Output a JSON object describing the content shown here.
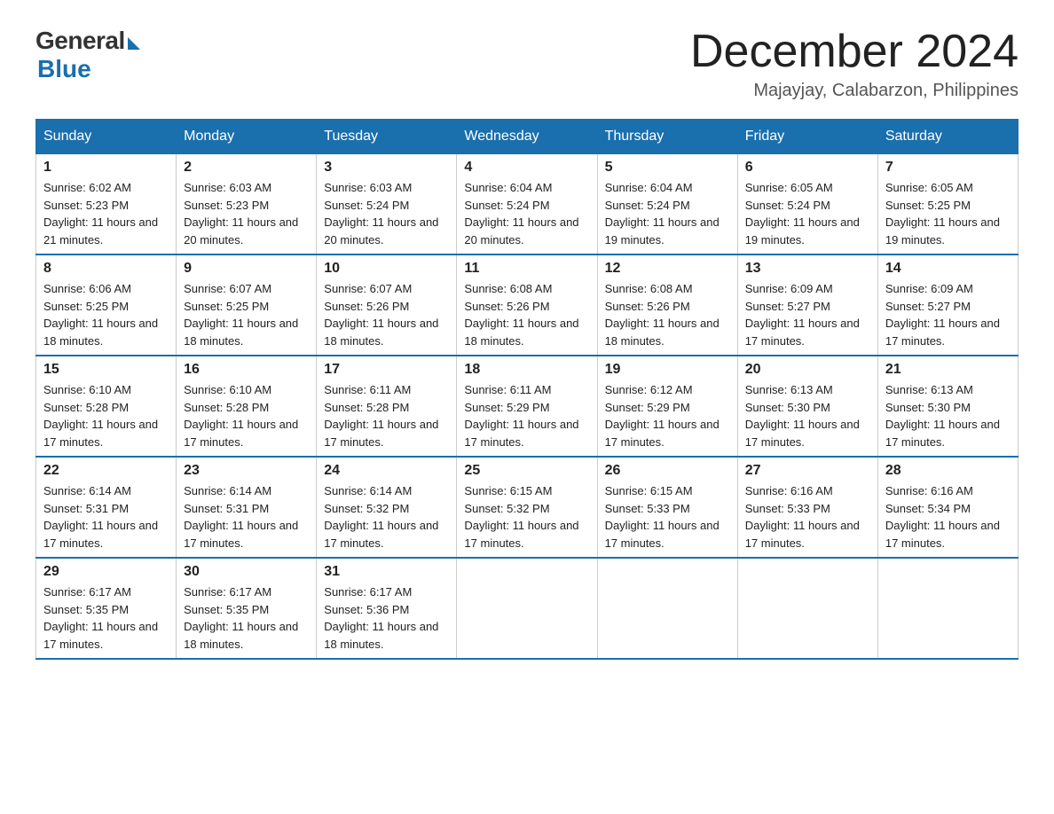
{
  "header": {
    "logo_general": "General",
    "logo_blue": "Blue",
    "month_title": "December 2024",
    "location": "Majayjay, Calabarzon, Philippines"
  },
  "weekdays": [
    "Sunday",
    "Monday",
    "Tuesday",
    "Wednesday",
    "Thursday",
    "Friday",
    "Saturday"
  ],
  "weeks": [
    [
      {
        "day": "1",
        "sunrise": "6:02 AM",
        "sunset": "5:23 PM",
        "daylight": "11 hours and 21 minutes."
      },
      {
        "day": "2",
        "sunrise": "6:03 AM",
        "sunset": "5:23 PM",
        "daylight": "11 hours and 20 minutes."
      },
      {
        "day": "3",
        "sunrise": "6:03 AM",
        "sunset": "5:24 PM",
        "daylight": "11 hours and 20 minutes."
      },
      {
        "day": "4",
        "sunrise": "6:04 AM",
        "sunset": "5:24 PM",
        "daylight": "11 hours and 20 minutes."
      },
      {
        "day": "5",
        "sunrise": "6:04 AM",
        "sunset": "5:24 PM",
        "daylight": "11 hours and 19 minutes."
      },
      {
        "day": "6",
        "sunrise": "6:05 AM",
        "sunset": "5:24 PM",
        "daylight": "11 hours and 19 minutes."
      },
      {
        "day": "7",
        "sunrise": "6:05 AM",
        "sunset": "5:25 PM",
        "daylight": "11 hours and 19 minutes."
      }
    ],
    [
      {
        "day": "8",
        "sunrise": "6:06 AM",
        "sunset": "5:25 PM",
        "daylight": "11 hours and 18 minutes."
      },
      {
        "day": "9",
        "sunrise": "6:07 AM",
        "sunset": "5:25 PM",
        "daylight": "11 hours and 18 minutes."
      },
      {
        "day": "10",
        "sunrise": "6:07 AM",
        "sunset": "5:26 PM",
        "daylight": "11 hours and 18 minutes."
      },
      {
        "day": "11",
        "sunrise": "6:08 AM",
        "sunset": "5:26 PM",
        "daylight": "11 hours and 18 minutes."
      },
      {
        "day": "12",
        "sunrise": "6:08 AM",
        "sunset": "5:26 PM",
        "daylight": "11 hours and 18 minutes."
      },
      {
        "day": "13",
        "sunrise": "6:09 AM",
        "sunset": "5:27 PM",
        "daylight": "11 hours and 17 minutes."
      },
      {
        "day": "14",
        "sunrise": "6:09 AM",
        "sunset": "5:27 PM",
        "daylight": "11 hours and 17 minutes."
      }
    ],
    [
      {
        "day": "15",
        "sunrise": "6:10 AM",
        "sunset": "5:28 PM",
        "daylight": "11 hours and 17 minutes."
      },
      {
        "day": "16",
        "sunrise": "6:10 AM",
        "sunset": "5:28 PM",
        "daylight": "11 hours and 17 minutes."
      },
      {
        "day": "17",
        "sunrise": "6:11 AM",
        "sunset": "5:28 PM",
        "daylight": "11 hours and 17 minutes."
      },
      {
        "day": "18",
        "sunrise": "6:11 AM",
        "sunset": "5:29 PM",
        "daylight": "11 hours and 17 minutes."
      },
      {
        "day": "19",
        "sunrise": "6:12 AM",
        "sunset": "5:29 PM",
        "daylight": "11 hours and 17 minutes."
      },
      {
        "day": "20",
        "sunrise": "6:13 AM",
        "sunset": "5:30 PM",
        "daylight": "11 hours and 17 minutes."
      },
      {
        "day": "21",
        "sunrise": "6:13 AM",
        "sunset": "5:30 PM",
        "daylight": "11 hours and 17 minutes."
      }
    ],
    [
      {
        "day": "22",
        "sunrise": "6:14 AM",
        "sunset": "5:31 PM",
        "daylight": "11 hours and 17 minutes."
      },
      {
        "day": "23",
        "sunrise": "6:14 AM",
        "sunset": "5:31 PM",
        "daylight": "11 hours and 17 minutes."
      },
      {
        "day": "24",
        "sunrise": "6:14 AM",
        "sunset": "5:32 PM",
        "daylight": "11 hours and 17 minutes."
      },
      {
        "day": "25",
        "sunrise": "6:15 AM",
        "sunset": "5:32 PM",
        "daylight": "11 hours and 17 minutes."
      },
      {
        "day": "26",
        "sunrise": "6:15 AM",
        "sunset": "5:33 PM",
        "daylight": "11 hours and 17 minutes."
      },
      {
        "day": "27",
        "sunrise": "6:16 AM",
        "sunset": "5:33 PM",
        "daylight": "11 hours and 17 minutes."
      },
      {
        "day": "28",
        "sunrise": "6:16 AM",
        "sunset": "5:34 PM",
        "daylight": "11 hours and 17 minutes."
      }
    ],
    [
      {
        "day": "29",
        "sunrise": "6:17 AM",
        "sunset": "5:35 PM",
        "daylight": "11 hours and 17 minutes."
      },
      {
        "day": "30",
        "sunrise": "6:17 AM",
        "sunset": "5:35 PM",
        "daylight": "11 hours and 18 minutes."
      },
      {
        "day": "31",
        "sunrise": "6:17 AM",
        "sunset": "5:36 PM",
        "daylight": "11 hours and 18 minutes."
      },
      null,
      null,
      null,
      null
    ]
  ]
}
